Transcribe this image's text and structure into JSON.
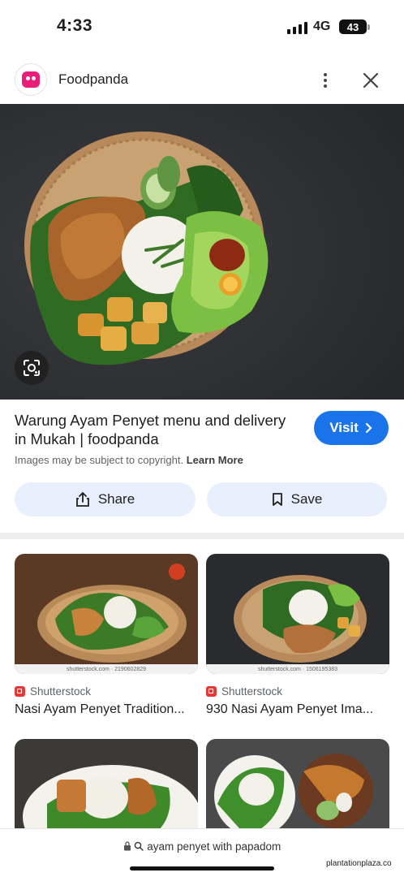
{
  "status_bar": {
    "time": "4:33",
    "network": "4G",
    "battery": "43"
  },
  "header": {
    "site_name": "Foodpanda",
    "logo_icon": "foodpanda-logo-icon",
    "colors": {
      "brand": "#e91e78"
    }
  },
  "result": {
    "title": "Warung Ayam Penyet menu and delivery in Mukah | foodpanda",
    "visit_label": "Visit",
    "copyright_text": "Images may be subject to copyright.",
    "learn_more": "Learn More",
    "share_label": "Share",
    "save_label": "Save"
  },
  "related": [
    {
      "source": "Shutterstock",
      "title": "Nasi Ayam Penyet Tradition...",
      "watermark": "shutterstock.com · 2190602829"
    },
    {
      "source": "Shutterstock",
      "title": "930 Nasi Ayam Penyet Ima...",
      "watermark": "shutterstock.com · 1506195383"
    },
    {
      "source": "",
      "title": "",
      "watermark": ""
    },
    {
      "source": "",
      "title": "",
      "watermark": ""
    }
  ],
  "url_bar": {
    "query": "ayam penyet with papadom"
  },
  "corner_watermark": "plantationplaza.co",
  "colors": {
    "accent": "#1a73e8",
    "action_bg": "#e8f0fe"
  }
}
